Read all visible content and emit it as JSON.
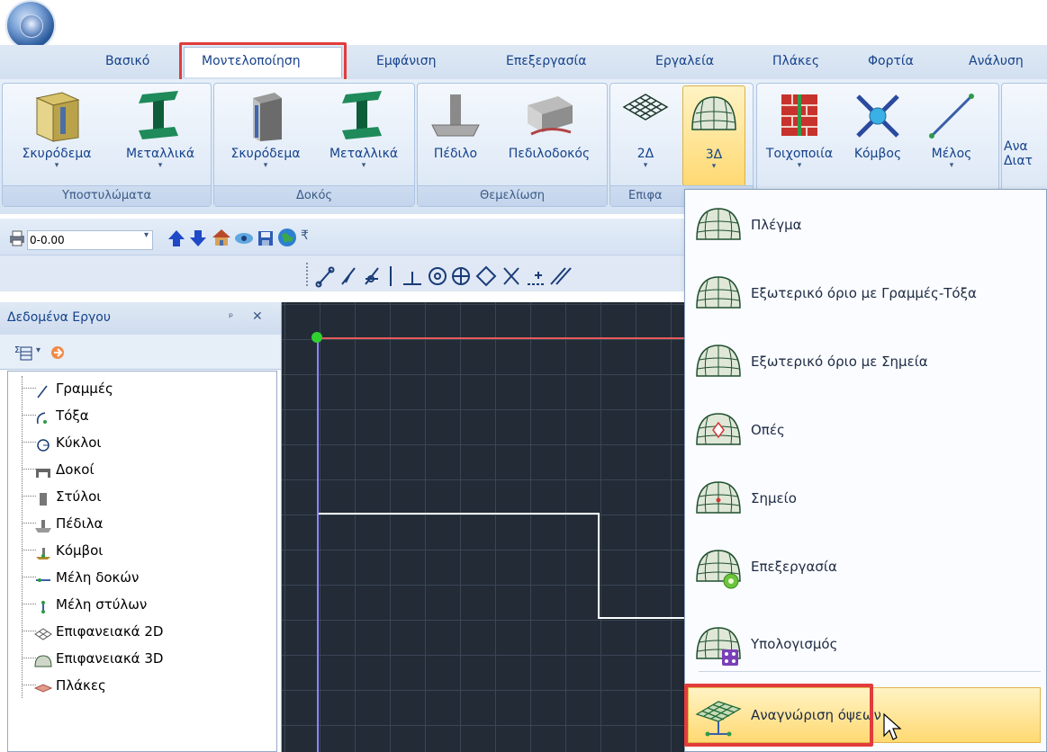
{
  "ribbon": {
    "tabs": [
      "Βασικό",
      "Μοντελοποίηση",
      "Εμφάνιση",
      "Επεξεργασία",
      "Εργαλεία",
      "Πλάκες",
      "Φορτία",
      "Ανάλυση"
    ],
    "active_tab": "Μοντελοποίηση",
    "groups": {
      "columns": {
        "label": "Υποστυλώματα",
        "concrete": "Σκυρόδεμα",
        "steel": "Μεταλλικά"
      },
      "beam": {
        "label": "Δοκός",
        "concrete": "Σκυρόδεμα",
        "steel": "Μεταλλικά"
      },
      "foundation": {
        "label": "Θεμελίωση",
        "footing": "Πέδιλο",
        "tie_beam": "Πεδιλοδοκός"
      },
      "surface": {
        "label": "Επιφα",
        "btn_2d": "2Δ",
        "btn_3d": "3Δ"
      },
      "members": {
        "wall": "Τοιχοποιία",
        "node": "Κόμβος",
        "member": "Μέλος",
        "cut_1": "Ανα",
        "cut_2": "Διατ"
      }
    }
  },
  "quick_access": {
    "level": "0-0.00"
  },
  "panel": {
    "title": "Δεδομένα Εργου",
    "pin": "ᵖ",
    "close": "✕",
    "tree": [
      "Γραμμές",
      "Τόξα",
      "Κύκλοι",
      "Δοκοί",
      "Στύλοι",
      "Πέδιλα",
      "Κόμβοι",
      "Μέλη δοκών",
      "Μέλη στύλων",
      "Επιφανειακά 2D",
      "Επιφανειακά 3D",
      "Πλάκες"
    ]
  },
  "menu": {
    "items": [
      "Πλέγμα",
      "Εξωτερικό όριο με Γραμμές-Τόξα",
      "Εξωτερικό όριο με Σημεία",
      "Οπές",
      "Σημείο",
      "Επεξεργασία",
      "Υπολογισμός",
      "Αναγνώριση όψεων"
    ],
    "highlighted": "Αναγνώριση όψεων"
  }
}
